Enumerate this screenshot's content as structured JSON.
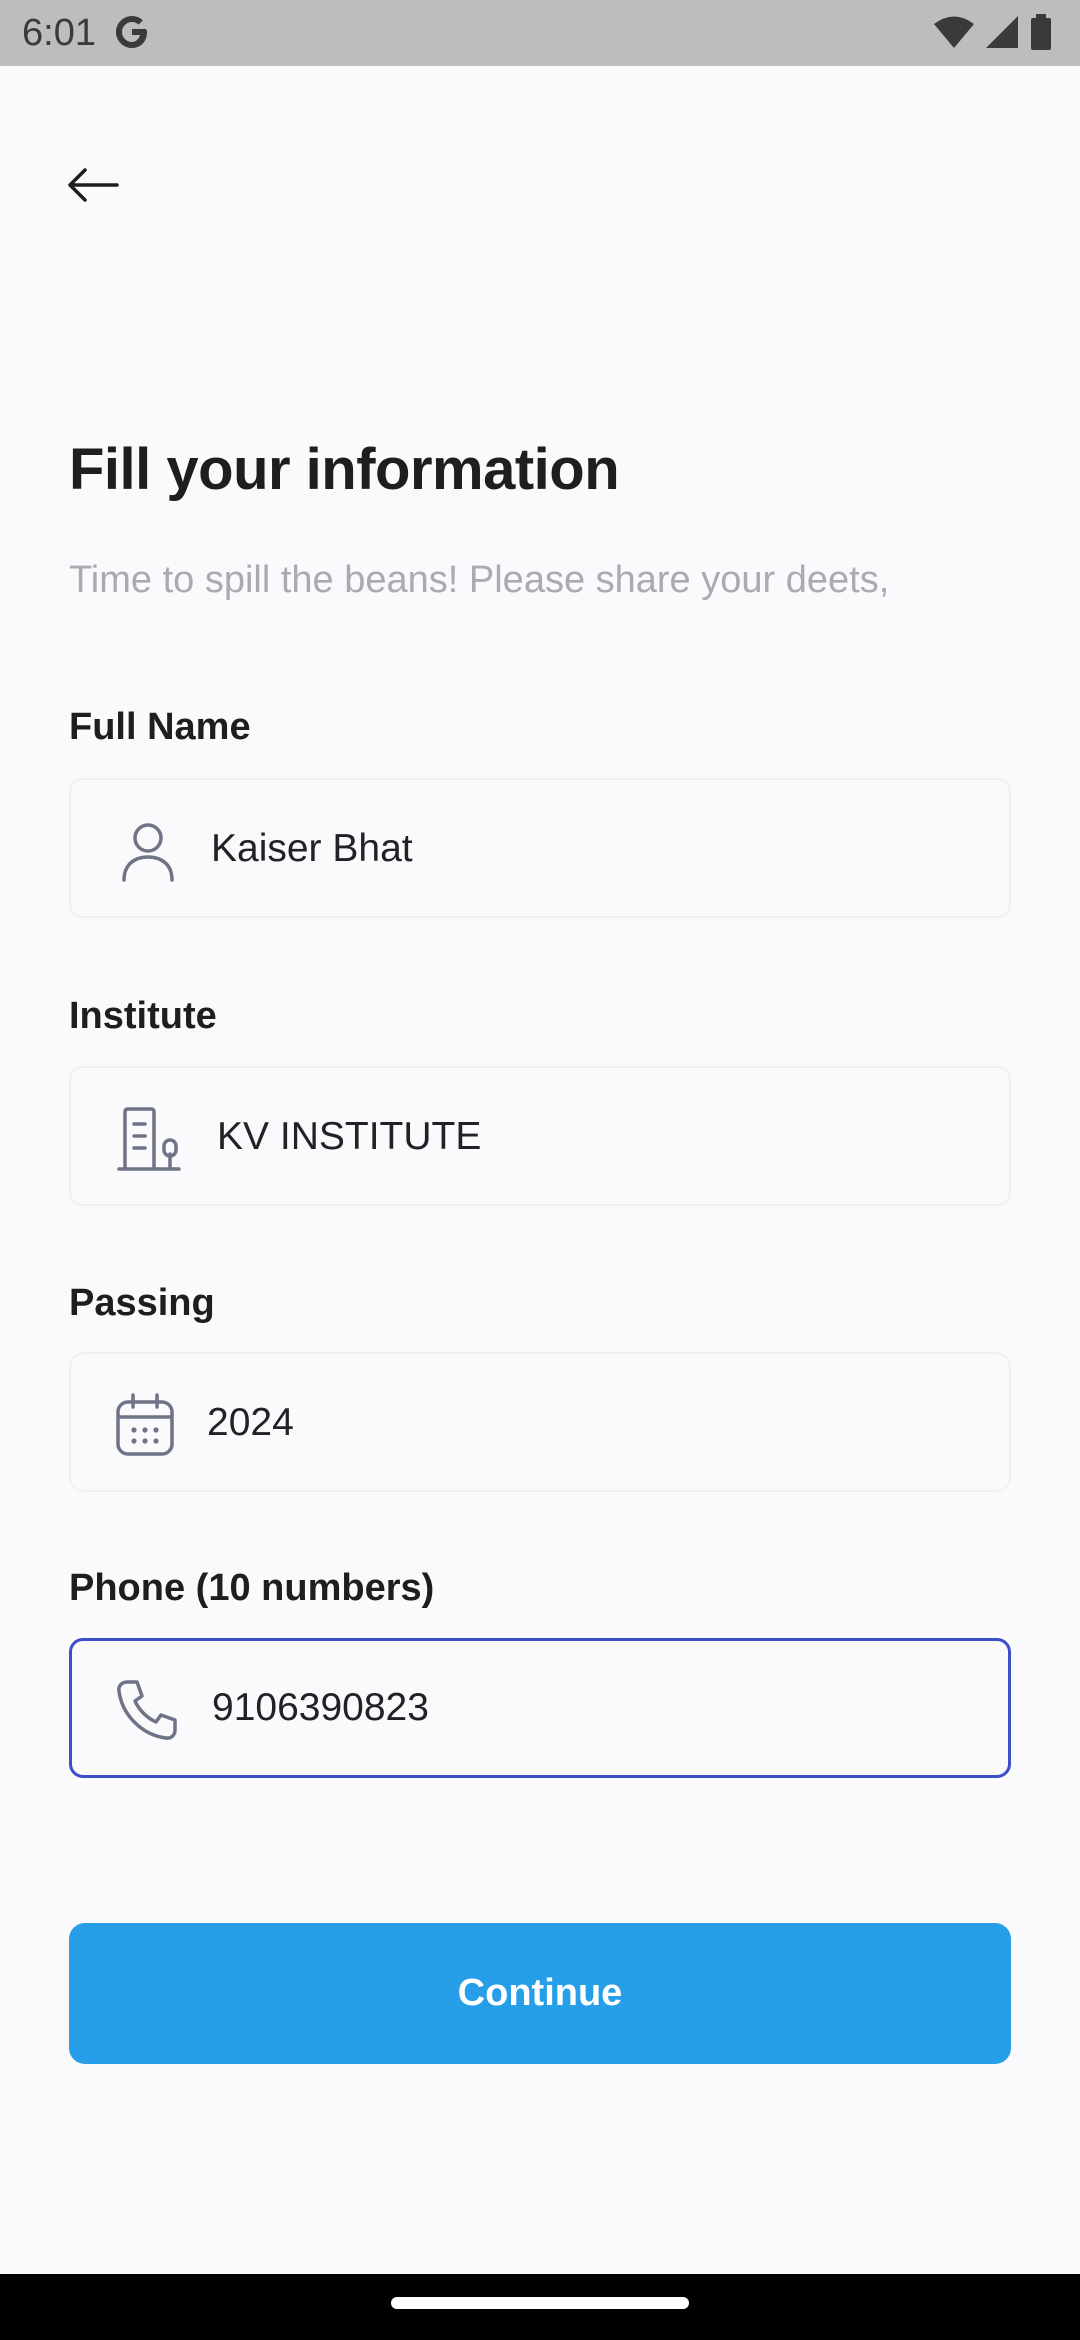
{
  "status_bar": {
    "time": "6:01",
    "icons": [
      "google-icon",
      "wifi-icon",
      "signal-icon",
      "battery-icon"
    ]
  },
  "header": {
    "back_icon": "arrow-left-icon"
  },
  "page": {
    "title": "Fill your information",
    "subtitle": "Time to spill the beans! Please share your deets,"
  },
  "form": {
    "full_name": {
      "label": "Full Name",
      "value": "Kaiser Bhat",
      "icon": "user-icon"
    },
    "institute": {
      "label": "Institute",
      "value": "KV INSTITUTE",
      "icon": "building-icon"
    },
    "passing": {
      "label": "Passing",
      "value": "2024",
      "icon": "calendar-icon"
    },
    "phone": {
      "label": "Phone (10 numbers)",
      "value": "9106390823",
      "icon": "phone-icon",
      "focused": true
    }
  },
  "actions": {
    "continue_label": "Continue"
  },
  "colors": {
    "background": "#FAFAFC",
    "primary_button": "#269FE8",
    "focus_border": "#3B4FC8",
    "subtitle": "#A9AAB2",
    "icon": "#6E7386"
  }
}
